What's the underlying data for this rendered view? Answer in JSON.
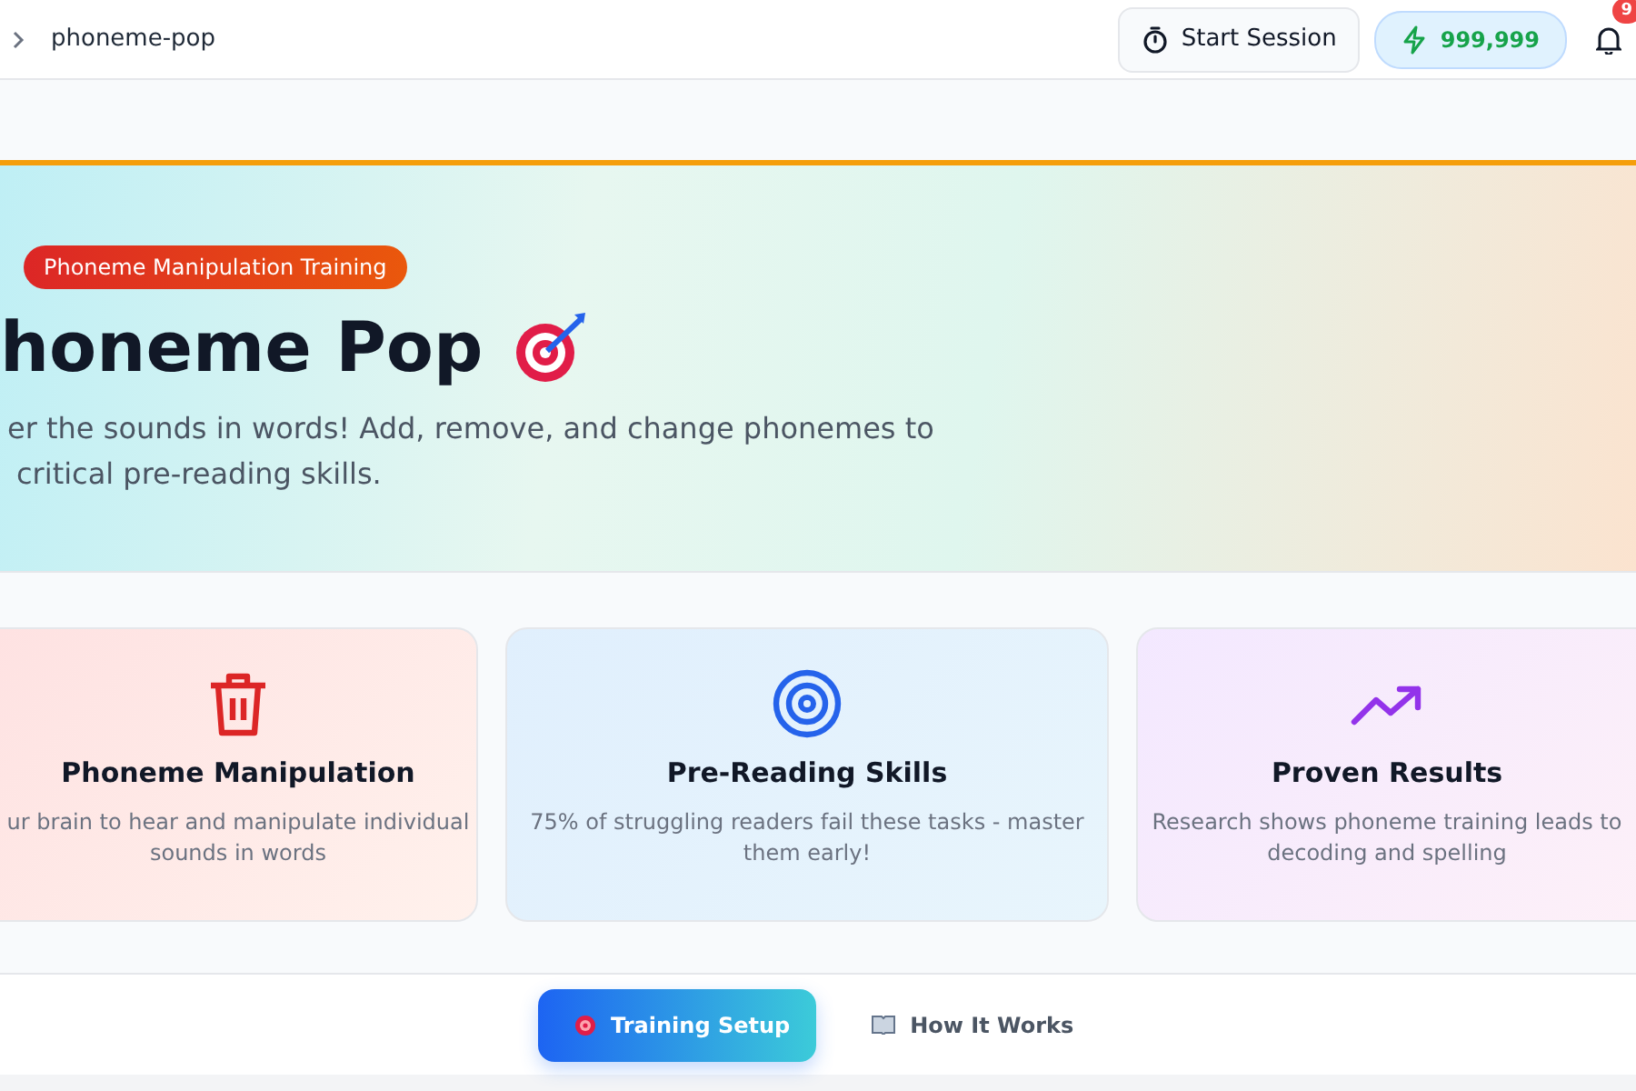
{
  "breadcrumb": {
    "page": "phoneme-pop"
  },
  "header": {
    "start_button": "Start Session",
    "points": "999,999",
    "notifications": "9"
  },
  "hero": {
    "badge": "Phoneme Manipulation Training",
    "title": "honeme Pop",
    "subtitle_lines": [
      "er the sounds in words! Add, remove, and change phonemes to",
      "critical pre-reading skills."
    ]
  },
  "features": [
    {
      "kind": "trash",
      "title": "Phoneme Manipulation",
      "lines": [
        "ur brain to hear and manipulate individual",
        "sounds in words"
      ]
    },
    {
      "kind": "target",
      "title": "Pre-Reading Skills",
      "lines": [
        "75% of struggling readers fail these tasks - master",
        "them early!"
      ]
    },
    {
      "kind": "trend",
      "title": "Proven Results",
      "lines": [
        "Research shows phoneme training leads to",
        "decoding and spelling"
      ]
    }
  ],
  "tabs": [
    {
      "kind": "target",
      "label": "Training Setup",
      "selected": true
    },
    {
      "kind": "book",
      "label": "How It Works",
      "selected": false
    }
  ]
}
